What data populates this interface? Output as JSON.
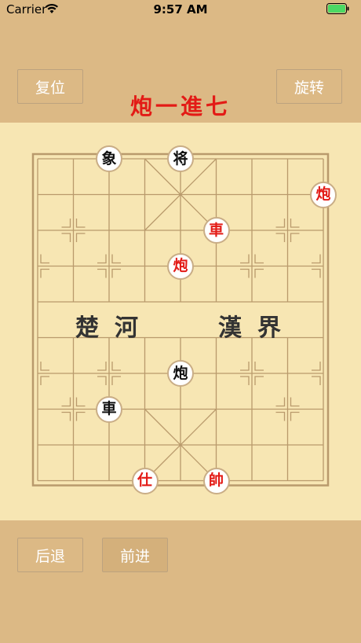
{
  "status_bar": {
    "carrier": "Carrier",
    "time": "9:57 AM"
  },
  "buttons": {
    "reset": "复位",
    "rotate": "旋转",
    "back": "后退",
    "forward": "前进"
  },
  "move_notation": "炮一進七",
  "river": {
    "left": "楚河",
    "right": "漢界"
  },
  "colors": {
    "red_piece": "#e31b16",
    "black_piece": "#111111",
    "board": "#f7e6b3",
    "background": "#dcb985"
  },
  "pieces": [
    {
      "label": "象",
      "side": "black",
      "file": 2,
      "rank": 0
    },
    {
      "label": "将",
      "side": "black",
      "file": 4,
      "rank": 0
    },
    {
      "label": "炮",
      "side": "red",
      "file": 8,
      "rank": 1
    },
    {
      "label": "車",
      "side": "red",
      "file": 5,
      "rank": 2
    },
    {
      "label": "炮",
      "side": "red",
      "file": 4,
      "rank": 3
    },
    {
      "label": "炮",
      "side": "black",
      "file": 4,
      "rank": 6
    },
    {
      "label": "車",
      "side": "black",
      "file": 2,
      "rank": 7
    },
    {
      "label": "仕",
      "side": "red",
      "file": 3,
      "rank": 9
    },
    {
      "label": "帥",
      "side": "red",
      "file": 5,
      "rank": 9
    }
  ]
}
